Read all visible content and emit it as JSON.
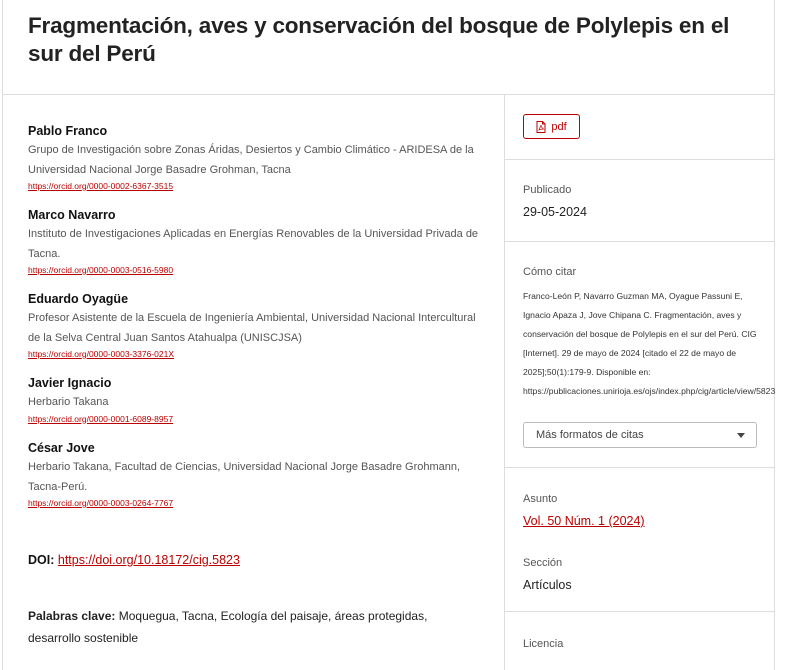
{
  "article": {
    "title": "Fragmentación, aves y conservación del bosque de Polylepis en el sur del Perú"
  },
  "authors": [
    {
      "name": "Pablo Franco",
      "affiliation": "Grupo de Investigación sobre Zonas Áridas, Desiertos y Cambio Climático - ARIDESA de la Universidad Nacional Jorge Basadre Grohman, Tacna",
      "orcid": "https://orcid.org/0000-0002-6367-3515"
    },
    {
      "name": "Marco Navarro",
      "affiliation": "Instituto de Investigaciones Aplicadas en Energías Renovables de la Universidad Privada de Tacna.",
      "orcid": "https://orcid.org/0000-0003-0516-5980"
    },
    {
      "name": "Eduardo Oyagüe",
      "affiliation": "Profesor Asistente de la Escuela de Ingeniería Ambiental, Universidad Nacional Intercultural de la Selva Central Juan Santos Atahualpa (UNISCJSA)",
      "orcid": "https://orcid.org/0000-0003-3376-021X"
    },
    {
      "name": "Javier Ignacio",
      "affiliation": "Herbario Takana",
      "orcid": "https://orcid.org/0000-0001-6089-8957"
    },
    {
      "name": "César Jove",
      "affiliation": "Herbario Takana, Facultad de Ciencias, Universidad Nacional Jorge Basadre Grohmann, Tacna-Perú.",
      "orcid": "https://orcid.org/0000-0003-0264-7767"
    }
  ],
  "doi": {
    "label": "DOI:",
    "link": "https://doi.org/10.18172/cig.5823"
  },
  "keywords": {
    "label": "Palabras clave:",
    "text": "Moquegua, Tacna, Ecología del paisaje, áreas protegidas, desarrollo sostenible"
  },
  "sidebar": {
    "pdf_label": "pdf",
    "published_label": "Publicado",
    "published_date": "29-05-2024",
    "cite_label": "Cómo citar",
    "cite_text": "Franco-León P, Navarro Guzman MA, Oyague Passuni E, Ignacio Apaza J, Jove Chipana C. Fragmentación, aves y conservación del bosque de Polylepis en el sur del Perú. CIG [Internet]. 29 de mayo de 2024 [citado el 22 de mayo de 2025];50(1):179-9. Disponible en: https://publicaciones.unirioja.es/ojs/index.php/cig/article/view/5823",
    "cite_formats": "Más formatos de citas",
    "issue_label": "Asunto",
    "issue_link": "Vol. 50 Núm. 1 (2024)",
    "section_label": "Sección",
    "section_value": "Artículos",
    "license_label": "Licencia"
  },
  "colors": {
    "accent": "#b00000",
    "border": "#dddddd"
  },
  "icons": {
    "pdf": "file-pdf-icon",
    "dropdown": "chevron-down-icon"
  }
}
